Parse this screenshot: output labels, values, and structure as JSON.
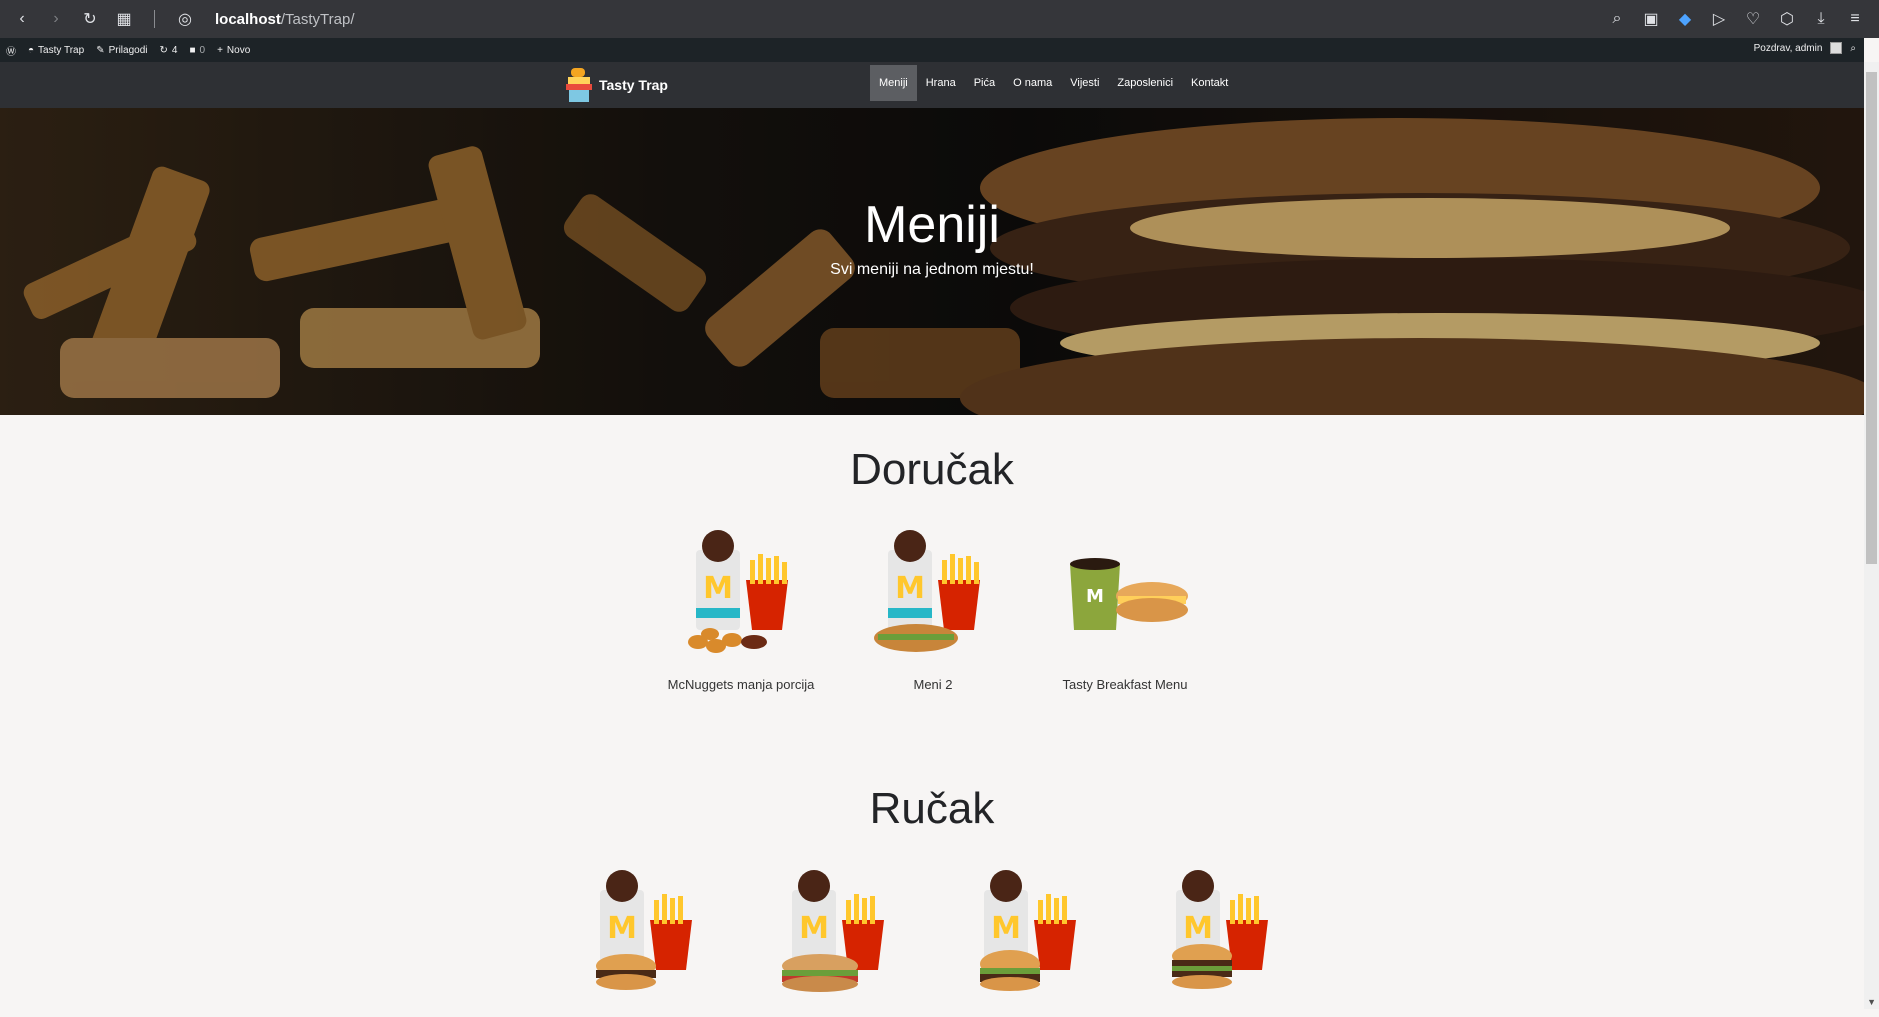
{
  "browser": {
    "url_host": "localhost",
    "url_path": "/TastyTrap/"
  },
  "wp_admin": {
    "site_name": "Tasty Trap",
    "customize": "Prilagodi",
    "updates_count": "4",
    "comments_count": "0",
    "new": "Novo",
    "greeting": "Pozdrav, admin"
  },
  "nav": {
    "logo_text": "Tasty Trap",
    "items": [
      "Meniji",
      "Hrana",
      "Pića",
      "O nama",
      "Vijesti",
      "Zaposlenici",
      "Kontakt"
    ]
  },
  "hero": {
    "title": "Meniji",
    "subtitle": "Svi meniji na jednom mjestu!"
  },
  "sections": [
    {
      "title": "Doručak",
      "items": [
        "McNuggets manja porcija",
        "Meni 2",
        "Tasty Breakfast Menu"
      ]
    },
    {
      "title": "Ručak",
      "items": [
        "",
        "",
        "",
        ""
      ]
    }
  ],
  "colors": {
    "nav_bg": "#2e3034",
    "page_bg": "#f7f5f4",
    "mcd_red": "#d62300",
    "mcd_yellow": "#ffc72c"
  }
}
